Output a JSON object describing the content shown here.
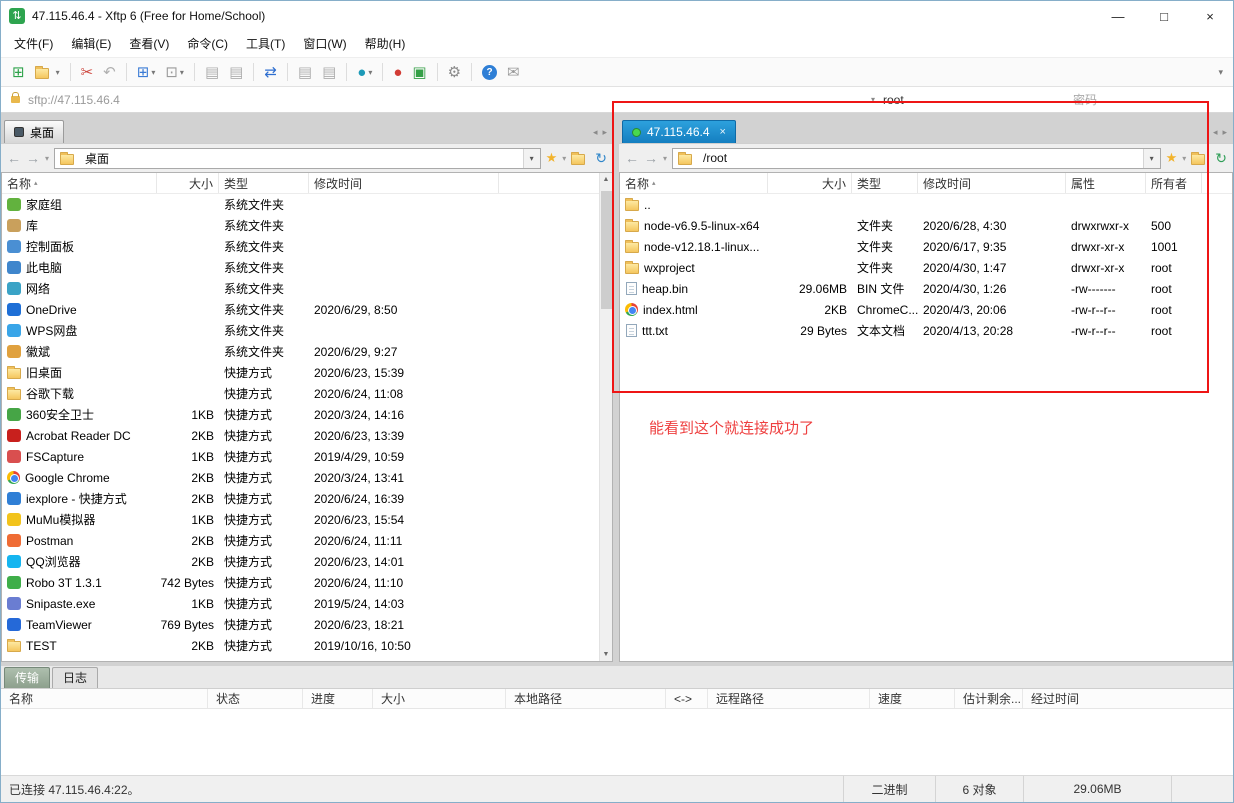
{
  "window": {
    "title": "47.115.46.4 - Xftp 6 (Free for Home/School)",
    "controls": {
      "minimize": "—",
      "maximize": "□",
      "close": "×"
    }
  },
  "menu": [
    "文件(F)",
    "编辑(E)",
    "查看(V)",
    "命令(C)",
    "工具(T)",
    "窗口(W)",
    "帮助(H)"
  ],
  "toolbar": {
    "buttons": [
      "new-session",
      "open-session",
      "cut",
      "undo",
      "new-transfer",
      "window-layout",
      "copy-doc",
      "paste-doc",
      "sync-browsing",
      "compare-left",
      "compare-right",
      "web-browser",
      "record",
      "execute",
      "settings",
      "help",
      "feedback"
    ]
  },
  "address_bar": {
    "url": "sftp://47.115.46.4",
    "user": "root",
    "password_placeholder": "密码"
  },
  "local_panel": {
    "tab": "桌面",
    "path": "桌面",
    "columns": [
      "名称",
      "大小",
      "类型",
      "修改时间"
    ],
    "rows": [
      {
        "name": "家庭组",
        "size": "",
        "type": "系统文件夹",
        "modified": "",
        "icon": "homegroup"
      },
      {
        "name": "库",
        "size": "",
        "type": "系统文件夹",
        "modified": "",
        "icon": "library"
      },
      {
        "name": "控制面板",
        "size": "",
        "type": "系统文件夹",
        "modified": "",
        "icon": "control-panel"
      },
      {
        "name": "此电脑",
        "size": "",
        "type": "系统文件夹",
        "modified": "",
        "icon": "computer"
      },
      {
        "name": "网络",
        "size": "",
        "type": "系统文件夹",
        "modified": "",
        "icon": "network"
      },
      {
        "name": "OneDrive",
        "size": "",
        "type": "系统文件夹",
        "modified": "2020/6/29, 8:50",
        "icon": "onedrive"
      },
      {
        "name": "WPS网盘",
        "size": "",
        "type": "系统文件夹",
        "modified": "",
        "icon": "wps"
      },
      {
        "name": "徽斌",
        "size": "",
        "type": "系统文件夹",
        "modified": "2020/6/29, 9:27",
        "icon": "user"
      },
      {
        "name": "旧桌面",
        "size": "",
        "type": "快捷方式",
        "modified": "2020/6/23, 15:39",
        "icon": "folder"
      },
      {
        "name": "谷歌下载",
        "size": "",
        "type": "快捷方式",
        "modified": "2020/6/24, 11:08",
        "icon": "folder"
      },
      {
        "name": "360安全卫士",
        "size": "1KB",
        "type": "快捷方式",
        "modified": "2020/3/24, 14:16",
        "icon": "shield"
      },
      {
        "name": "Acrobat Reader DC",
        "size": "2KB",
        "type": "快捷方式",
        "modified": "2020/6/23, 13:39",
        "icon": "acrobat"
      },
      {
        "name": "FSCapture",
        "size": "1KB",
        "type": "快捷方式",
        "modified": "2019/4/29, 10:59",
        "icon": "fscapture"
      },
      {
        "name": "Google Chrome",
        "size": "2KB",
        "type": "快捷方式",
        "modified": "2020/3/24, 13:41",
        "icon": "chrome"
      },
      {
        "name": "iexplore - 快捷方式",
        "size": "2KB",
        "type": "快捷方式",
        "modified": "2020/6/24, 16:39",
        "icon": "ie"
      },
      {
        "name": "MuMu模拟器",
        "size": "1KB",
        "type": "快捷方式",
        "modified": "2020/6/23, 15:54",
        "icon": "mumu"
      },
      {
        "name": "Postman",
        "size": "2KB",
        "type": "快捷方式",
        "modified": "2020/6/24, 11:11",
        "icon": "postman"
      },
      {
        "name": "QQ浏览器",
        "size": "2KB",
        "type": "快捷方式",
        "modified": "2020/6/23, 14:01",
        "icon": "qq"
      },
      {
        "name": "Robo 3T 1.3.1",
        "size": "742 Bytes",
        "type": "快捷方式",
        "modified": "2020/6/24, 11:10",
        "icon": "robo"
      },
      {
        "name": "Snipaste.exe",
        "size": "1KB",
        "type": "快捷方式",
        "modified": "2019/5/24, 14:03",
        "icon": "snipaste"
      },
      {
        "name": "TeamViewer",
        "size": "769 Bytes",
        "type": "快捷方式",
        "modified": "2020/6/23, 18:21",
        "icon": "teamviewer"
      },
      {
        "name": "TEST",
        "size": "2KB",
        "type": "快捷方式",
        "modified": "2019/10/16, 10:50",
        "icon": "folder"
      }
    ]
  },
  "remote_panel": {
    "tab": "47.115.46.4",
    "path": "/root",
    "columns": [
      "名称",
      "大小",
      "类型",
      "修改时间",
      "属性",
      "所有者"
    ],
    "rows": [
      {
        "name": "..",
        "size": "",
        "type": "",
        "modified": "",
        "attr": "",
        "owner": "",
        "icon": "folder"
      },
      {
        "name": "node-v6.9.5-linux-x64",
        "size": "",
        "type": "文件夹",
        "modified": "2020/6/28, 4:30",
        "attr": "drwxrwxr-x",
        "owner": "500",
        "icon": "folder"
      },
      {
        "name": "node-v12.18.1-linux...",
        "size": "",
        "type": "文件夹",
        "modified": "2020/6/17, 9:35",
        "attr": "drwxr-xr-x",
        "owner": "1001",
        "icon": "folder"
      },
      {
        "name": "wxproject",
        "size": "",
        "type": "文件夹",
        "modified": "2020/4/30, 1:47",
        "attr": "drwxr-xr-x",
        "owner": "root",
        "icon": "folder"
      },
      {
        "name": "heap.bin",
        "size": "29.06MB",
        "type": "BIN 文件",
        "modified": "2020/4/30, 1:26",
        "attr": "-rw-------",
        "owner": "root",
        "icon": "file"
      },
      {
        "name": "index.html",
        "size": "2KB",
        "type": "ChromeC...",
        "modified": "2020/4/3, 20:06",
        "attr": "-rw-r--r--",
        "owner": "root",
        "icon": "chrome"
      },
      {
        "name": "ttt.txt",
        "size": "29 Bytes",
        "type": "文本文档",
        "modified": "2020/4/13, 20:28",
        "attr": "-rw-r--r--",
        "owner": "root",
        "icon": "text-file"
      }
    ]
  },
  "annotation": {
    "text": "能看到这个就连接成功了"
  },
  "transfer_panel": {
    "tabs": [
      "传输",
      "日志"
    ],
    "columns": [
      "名称",
      "状态",
      "进度",
      "大小",
      "本地路径",
      "<->",
      "远程路径",
      "速度",
      "估计剩余...",
      "经过时间"
    ]
  },
  "status_bar": {
    "connection": "已连接 47.115.46.4:22。",
    "mode": "二进制",
    "objects": "6 对象",
    "total_size": "29.06MB"
  }
}
